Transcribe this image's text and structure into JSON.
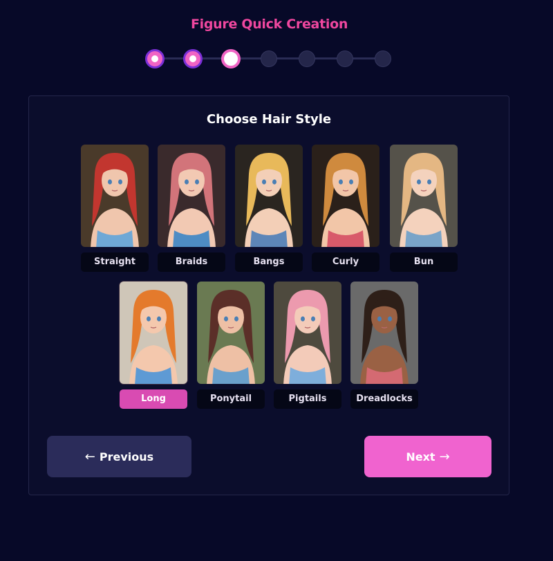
{
  "header": {
    "title": "Figure Quick Creation"
  },
  "stepper": {
    "total": 7,
    "current": 3,
    "steps": [
      "done",
      "done",
      "current",
      "pending",
      "pending",
      "pending",
      "pending"
    ]
  },
  "panel": {
    "title": "Choose Hair Style"
  },
  "hair_styles": [
    {
      "label": "Straight",
      "selected": false,
      "hair": "#c2362f",
      "skin": "#f0c6ad",
      "bg": "#4a3a2a",
      "swim": "#6fa8d6"
    },
    {
      "label": "Braids",
      "selected": false,
      "hair": "#d2747a",
      "skin": "#f2c9b3",
      "bg": "#3a2a2c",
      "swim": "#4e8cc4"
    },
    {
      "label": "Bangs",
      "selected": false,
      "hair": "#e8b95a",
      "skin": "#f3cfb7",
      "bg": "#2a2520",
      "swim": "#5d86b8"
    },
    {
      "label": "Curly",
      "selected": false,
      "hair": "#cf8a3e",
      "skin": "#f2c6a8",
      "bg": "#2a201a",
      "swim": "#d85a6a"
    },
    {
      "label": "Bun",
      "selected": false,
      "hair": "#e4b783",
      "skin": "#f4d2bd",
      "bg": "#55524a",
      "swim": "#7aa4c8"
    },
    {
      "label": "Long",
      "selected": true,
      "hair": "#e47a2c",
      "skin": "#f4c8ad",
      "bg": "#cfc6b8",
      "swim": "#5e9ad4"
    },
    {
      "label": "Ponytail",
      "selected": false,
      "hair": "#5b2f28",
      "skin": "#eec0a5",
      "bg": "#6a7a52",
      "swim": "#6aa0cc"
    },
    {
      "label": "Pigtails",
      "selected": false,
      "hair": "#ec9aae",
      "skin": "#f3cbb9",
      "bg": "#4e4a3e",
      "swim": "#7eaedb"
    },
    {
      "label": "Dreadlocks",
      "selected": false,
      "hair": "#2e1f18",
      "skin": "#9a6144",
      "bg": "#6a6a6a",
      "swim": "#d46a72"
    }
  ],
  "buttons": {
    "previous_label": "Previous",
    "next_label": "Next",
    "previous_icon": "arrow-left-icon",
    "next_icon": "arrow-right-icon"
  },
  "colors": {
    "accent": "#f063cf",
    "title": "#f0479f",
    "background": "#070928",
    "panel": "#0b0d2c"
  }
}
